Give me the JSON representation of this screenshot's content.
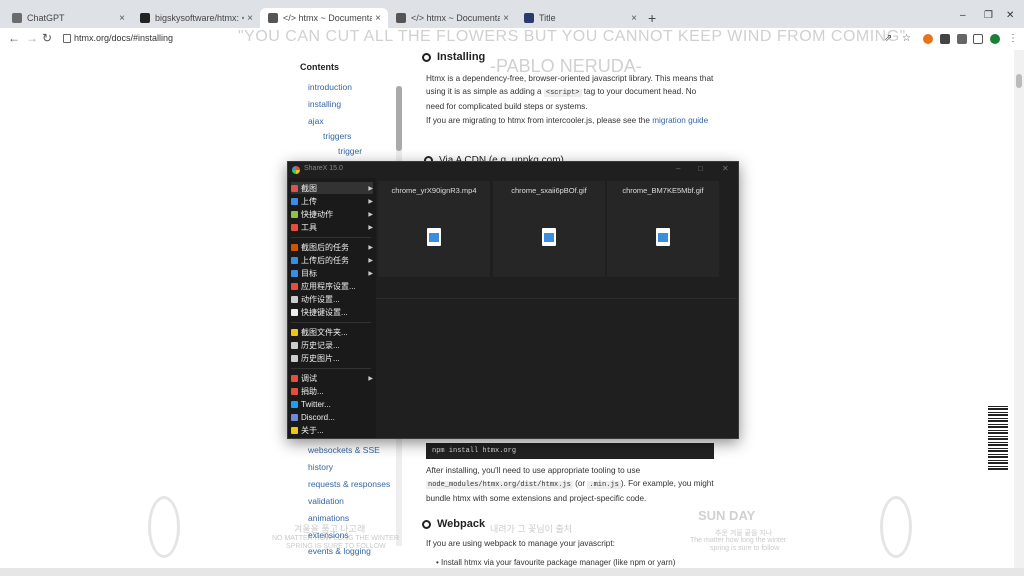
{
  "browser": {
    "tabs": [
      {
        "label": "ChatGPT",
        "icon": "chatgpt-icon",
        "color": "#6b6b6b",
        "active": false
      },
      {
        "label": "bigskysoftware/htmx: </> htm",
        "icon": "github-icon",
        "color": "#222222",
        "active": false
      },
      {
        "label": "</> htmx ~ Documentation",
        "icon": "globe-icon",
        "color": "#555555",
        "active": true
      },
      {
        "label": "</> htmx ~ Documentation",
        "icon": "globe-icon",
        "color": "#555555",
        "active": false
      },
      {
        "label": "Title",
        "icon": "page-icon",
        "color": "#2a3a6a",
        "active": false
      }
    ],
    "url": "htmx.org/docs/#installing"
  },
  "overlay": {
    "quote": "\"YOU CAN CUT ALL THE FLOWERS BUT YOU CANNOT KEEP WIND FROM COMING\"",
    "author": "-PABLO NERUDA-",
    "korean_line1": "내려가 그 꽃님이 출처",
    "korean_left1": "겨울을 품고 나고래",
    "korean_left2": "NO MATTER HOW LONG THE WINTER",
    "korean_left3": "SPRING IS SURE TO FOLLOW",
    "sunday_logo": "SUN DAY",
    "sunday_sub1": "추운 겨울 끝을 지나",
    "sunday_sub2": "The matter how long the winter",
    "sunday_sub3": "spring is sure to follow"
  },
  "docs": {
    "contents_title": "Contents",
    "sidebar": [
      {
        "label": "introduction",
        "level": 1
      },
      {
        "label": "installing",
        "level": 1
      },
      {
        "label": "ajax",
        "level": 1
      },
      {
        "label": "triggers",
        "level": 2
      },
      {
        "label": "trigger",
        "level": 3
      },
      {
        "label": "websockets & SSE",
        "level": 1
      },
      {
        "label": "history",
        "level": 1
      },
      {
        "label": "requests & responses",
        "level": 1
      },
      {
        "label": "validation",
        "level": 1
      },
      {
        "label": "animations",
        "level": 1
      },
      {
        "label": "extensions",
        "level": 1
      },
      {
        "label": "events & logging",
        "level": 1
      }
    ],
    "installing_heading": "Installing",
    "intro_text_1": "Htmx is a dependency-free, browser-oriented javascript library. This means that using it is as simple as adding a",
    "intro_code": "<script>",
    "intro_text_2": "tag to your document head. No need for complicated build steps or systems.",
    "migrate_text": "If you are migrating to htmx from intercooler.js, please see the",
    "migrate_link": "migration guide",
    "cdn_heading": "Via A CDN (e.g. unpkg.com)",
    "npm_command": "npm install htmx.org",
    "after_text_1": "After installing, you'll need to use appropriate tooling to use",
    "after_code_1": "node_modules/htmx.org/dist/htmx.js",
    "after_text_2": "(or",
    "after_code_2": ".min.js",
    "after_text_3": "). For example, you might bundle htmx with some extensions and project-specific code.",
    "webpack_heading": "Webpack",
    "webpack_text": "If you are using webpack to manage your javascript:",
    "webpack_bullet": "Install htmx via your favourite package manager (like npm or yarn)"
  },
  "sharex": {
    "title": "ShareX 15.0",
    "menu": [
      {
        "label": "截图",
        "icon": "#d9534f",
        "arrow": true,
        "selected": true
      },
      {
        "label": "上传",
        "icon": "#3b8de0",
        "arrow": true
      },
      {
        "label": "快捷动作",
        "icon": "#8bc34a",
        "arrow": true
      },
      {
        "label": "工具",
        "icon": "#e74c3c",
        "arrow": true
      },
      {
        "sep": true
      },
      {
        "label": "截图后的任务",
        "icon": "#d35400",
        "arrow": true
      },
      {
        "label": "上传后的任务",
        "icon": "#3b8de0",
        "arrow": true
      },
      {
        "label": "目标",
        "icon": "#3b8de0",
        "arrow": true
      },
      {
        "label": "应用程序设置...",
        "icon": "#e74c3c",
        "arrow": false
      },
      {
        "label": "动作设置...",
        "icon": "#cccccc",
        "arrow": false
      },
      {
        "label": "快捷键设置...",
        "icon": "#eeeeee",
        "arrow": false
      },
      {
        "sep": true
      },
      {
        "label": "截图文件夹...",
        "icon": "#f1c40f",
        "arrow": false
      },
      {
        "label": "历史记录...",
        "icon": "#cccccc",
        "arrow": false
      },
      {
        "label": "历史图片...",
        "icon": "#cccccc",
        "arrow": false
      },
      {
        "sep": true
      },
      {
        "label": "调试",
        "icon": "#e74c3c",
        "arrow": true
      },
      {
        "label": "捐助...",
        "icon": "#e74c3c",
        "arrow": false
      },
      {
        "label": "Twitter...",
        "icon": "#1da1f2",
        "arrow": false
      },
      {
        "label": "Discord...",
        "icon": "#7289da",
        "arrow": false
      },
      {
        "label": "关于...",
        "icon": "#f1c40f",
        "arrow": false
      }
    ],
    "files": [
      {
        "name": "chrome_yrX90ignR3.mp4",
        "icon": "video-file-icon"
      },
      {
        "name": "chrome_sxaii6pBOf.gif",
        "icon": "image-file-icon"
      },
      {
        "name": "chrome_BM7KE5Mbf.gif",
        "icon": "image-file-icon"
      }
    ]
  }
}
